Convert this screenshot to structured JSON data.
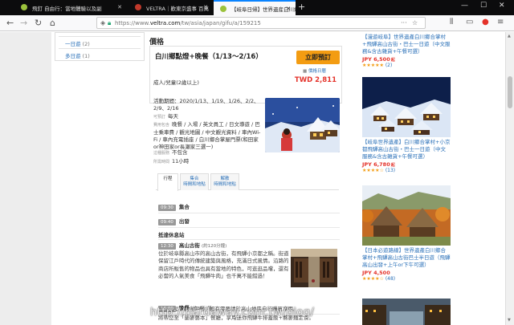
{
  "browser": {
    "tabs": [
      {
        "label": "飛釘 自由行：當地體驗以及副"
      },
      {
        "label": "VELTRA｜歡東京盛事 百萬"
      },
      {
        "label": "【岐阜日帰】世界遺産白川郷お"
      }
    ],
    "url_prefix": "https://www.",
    "url_domain": "veltra.com",
    "url_path": "/tw/asia/japan/gifu/a/159215"
  },
  "sidebar": {
    "durations": [
      {
        "label": "一日遊",
        "count": "(2)"
      },
      {
        "label": "多日遊",
        "count": "(1)"
      }
    ]
  },
  "product": {
    "section_title": "價格",
    "title": "白川鄉點燈+晚餐（1/13～2/16）",
    "book_button": "立即預訂",
    "calendar_link": "價格日曆",
    "price_label": "成人/兒童(2歲以上)",
    "price": "TWD 2,811",
    "info": [
      {
        "label": "活動期間：",
        "value": "2020/1/13、1/19、1/26、2/2、2/9、2/16"
      },
      {
        "label": "可預訂",
        "value": "每天"
      },
      {
        "label": "費用包含",
        "value": "晚餐 / 入場 / 英文員工 / 日文導遊 / 巴士乘車費 / 觀光地圖 / 中文觀光資料 / 車內Wi-Fi / 車內充電插座 / 白川鄉合掌屋門票(和田家or神田家or長瀬家三選一)"
      },
      {
        "label": "這種服務",
        "value": "不包含"
      },
      {
        "label": "所需時間",
        "value": "11小時"
      }
    ],
    "tabs": [
      {
        "label": "行程"
      },
      {
        "label": "集合\n時間和地點"
      },
      {
        "label": "解散\n時間和地點"
      }
    ],
    "schedule": [
      {
        "time": "09:30",
        "title": "集合",
        "note": ""
      },
      {
        "time": "09:40",
        "title": "出發",
        "note": ""
      }
    ],
    "subheading": "抵達休息站",
    "stop": {
      "time": "12:30",
      "title": "高山古街",
      "note": "(約120分鐘)"
    },
    "stop_desc": "位於岐阜縣高山市的高山古街，有飛驒小京都之稱。街道保留江戶時代的傳統建築與風格，充滿日式風情。沿路的商店所販售的物品也具有當地的特色，可逛逛品嚐，還有必嘗的人氣美食「飛驒牛肉」也千萬不能錯過！",
    "stop_note": "※本行程不包含午餐，如有需要請於高山地區自行購買享用。",
    "dinner": {
      "time": "16:00",
      "title": "晚餐",
      "note": "(約60分鐘)"
    },
    "dinner_desc": "將帶您至「蘭麥藝本」餐廳，享用迷你飛驒牛排蓋飯+蕎麥麵定食。"
  },
  "related": [
    {
      "title": "【漫遊岐阜】世界遺產白川鄉合掌村+飛驒高山古街・巴士一日遊（中文服務&含古雜貨+午餐可選）",
      "price": "JPY 6,500",
      "unit": "起",
      "stars": "★★★★★",
      "count": "(2)"
    },
    {
      "title": "【岐阜世界遺產】白川鄉合掌村+小京都飛驒高山古街・巴士一日遊（中文服務&含古雜貨+午餐可選）",
      "price": "JPY 6,780",
      "unit": "起",
      "stars": "★★★★☆",
      "count": "(13)"
    },
    {
      "title": "【日本必遊路線】世界遺產白川鄉合掌村+飛驒高山古街巴士半日遊（飛驒高山出發+上午or下午可選）",
      "price": "JPY 4,500",
      "unit": "",
      "stars": "★★★★☆",
      "count": "(48)"
    }
  ],
  "watermark": "http://hardaway.com.tw/blog/"
}
